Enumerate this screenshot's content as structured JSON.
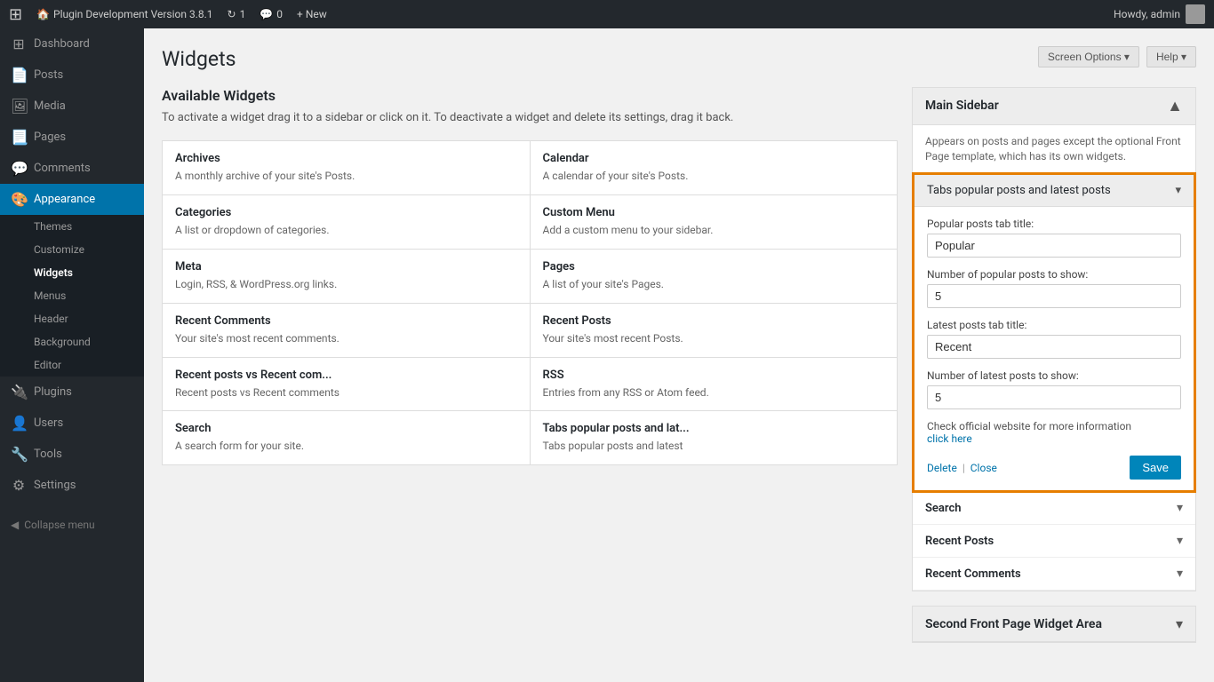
{
  "adminbar": {
    "site_name": "Plugin Development Version 3.8.1",
    "updates": "1",
    "comments": "0",
    "new_label": "+ New",
    "howdy": "Howdy, admin"
  },
  "sidebar_menu": {
    "items": [
      {
        "id": "dashboard",
        "label": "Dashboard",
        "icon": "⊞"
      },
      {
        "id": "posts",
        "label": "Posts",
        "icon": "📄"
      },
      {
        "id": "media",
        "label": "Media",
        "icon": "🖼"
      },
      {
        "id": "pages",
        "label": "Pages",
        "icon": "📃"
      },
      {
        "id": "comments",
        "label": "Comments",
        "icon": "💬"
      },
      {
        "id": "appearance",
        "label": "Appearance",
        "icon": "🎨",
        "active": true
      },
      {
        "id": "plugins",
        "label": "Plugins",
        "icon": "🔌"
      },
      {
        "id": "users",
        "label": "Users",
        "icon": "👤"
      },
      {
        "id": "tools",
        "label": "Tools",
        "icon": "🔧"
      },
      {
        "id": "settings",
        "label": "Settings",
        "icon": "⚙"
      }
    ],
    "appearance_submenu": [
      {
        "id": "themes",
        "label": "Themes"
      },
      {
        "id": "customize",
        "label": "Customize"
      },
      {
        "id": "widgets",
        "label": "Widgets",
        "active": true
      },
      {
        "id": "menus",
        "label": "Menus"
      },
      {
        "id": "header",
        "label": "Header"
      },
      {
        "id": "background",
        "label": "Background"
      },
      {
        "id": "editor",
        "label": "Editor"
      }
    ],
    "collapse_label": "Collapse menu"
  },
  "page": {
    "title": "Widgets",
    "screen_options_label": "Screen Options ▾",
    "help_label": "Help ▾"
  },
  "available_widgets": {
    "title": "Available Widgets",
    "description": "To activate a widget drag it to a sidebar or click on it. To deactivate a\nwidget and delete its settings, drag it back.",
    "widgets": [
      {
        "name": "Archives",
        "desc": "A monthly archive of your site's Posts."
      },
      {
        "name": "Calendar",
        "desc": "A calendar of your site's Posts."
      },
      {
        "name": "Categories",
        "desc": "A list or dropdown of categories."
      },
      {
        "name": "Custom Menu",
        "desc": "Add a custom menu to your sidebar."
      },
      {
        "name": "Meta",
        "desc": "Login, RSS, & WordPress.org links."
      },
      {
        "name": "Pages",
        "desc": "A list of your site's Pages."
      },
      {
        "name": "Recent Comments",
        "desc": "Your site's most recent comments."
      },
      {
        "name": "Recent Posts",
        "desc": "Your site's most recent Posts."
      },
      {
        "name": "Recent posts vs Recent com...",
        "desc": "Recent posts vs Recent comments"
      },
      {
        "name": "RSS",
        "desc": "Entries from any RSS or Atom feed."
      },
      {
        "name": "Search",
        "desc": "A search form for your site."
      },
      {
        "name": "Tabs popular posts and lat...",
        "desc": "Tabs popular posts and latest"
      }
    ]
  },
  "main_sidebar": {
    "title": "Main Sidebar",
    "toggle": "▲",
    "description": "Appears on posts and pages except the optional Front Page template, which has its own widgets.",
    "expanded_widget": {
      "title": "Tabs popular posts and latest posts",
      "toggle": "▾",
      "fields": {
        "popular_tab_title_label": "Popular posts tab title:",
        "popular_tab_title_value": "Popular",
        "popular_count_label": "Number of popular posts to show:",
        "popular_count_value": "5",
        "latest_tab_title_label": "Latest posts tab title:",
        "latest_tab_title_value": "Recent",
        "latest_count_label": "Number of latest posts to show:",
        "latest_count_value": "5"
      },
      "info_text": "Check official website for more information",
      "info_link": "click here",
      "delete_label": "Delete",
      "separator": "|",
      "close_label": "Close",
      "save_label": "Save"
    },
    "search_widget": {
      "title": "Search",
      "toggle": "▾"
    },
    "recent_posts_widget": {
      "title": "Recent Posts",
      "toggle": "▾"
    },
    "recent_comments_widget": {
      "title": "Recent Comments",
      "toggle": "▾"
    }
  },
  "second_sidebar": {
    "title": "Second Front Page Widget Area",
    "toggle": "▾"
  }
}
